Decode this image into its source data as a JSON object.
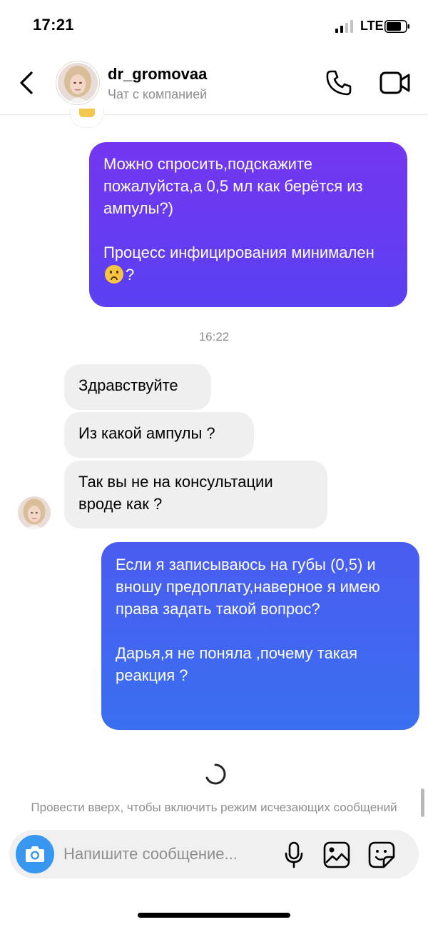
{
  "status_bar": {
    "time": "17:21",
    "network": "LTE"
  },
  "header": {
    "username": "dr_gromovaa",
    "subtitle": "Чат с компанией"
  },
  "messages": [
    {
      "direction": "outgoing",
      "text": "Можно спросить,подскажите пожалуйста,а 0,5 мл как берётся из ампулы?)\n\nПроцесс инфицирования минимален",
      "suffix_emoji": "slightly-frowning-face",
      "suffix_text": "?"
    },
    {
      "type": "timestamp",
      "text": "16:22"
    },
    {
      "direction": "incoming",
      "text": "Здравствуйте"
    },
    {
      "direction": "incoming",
      "text": "Из какой ампулы ?"
    },
    {
      "direction": "incoming",
      "text": "Так вы не на консультации вроде как ?"
    },
    {
      "direction": "outgoing",
      "text": "Если я записываюсь на губы (0,5) и вношу предоплату,наверное я имею права задать такой вопрос?\n\nДарья,я не поняла ,почему такая реакция ?"
    }
  ],
  "hint": {
    "text": "Провести вверх, чтобы включить режим исчезающих сообщений"
  },
  "composer": {
    "placeholder": "Напишите сообщение..."
  },
  "colors": {
    "outgoing_top": "#7436f0",
    "outgoing_bottom": "#3a6ff0",
    "incoming_bg": "#efefef",
    "camera_button": "#3897f0"
  },
  "icons": [
    "back-chevron-icon",
    "phone-icon",
    "video-camera-icon",
    "camera-icon",
    "microphone-icon",
    "gallery-icon",
    "sticker-icon",
    "loading-spinner-icon"
  ]
}
